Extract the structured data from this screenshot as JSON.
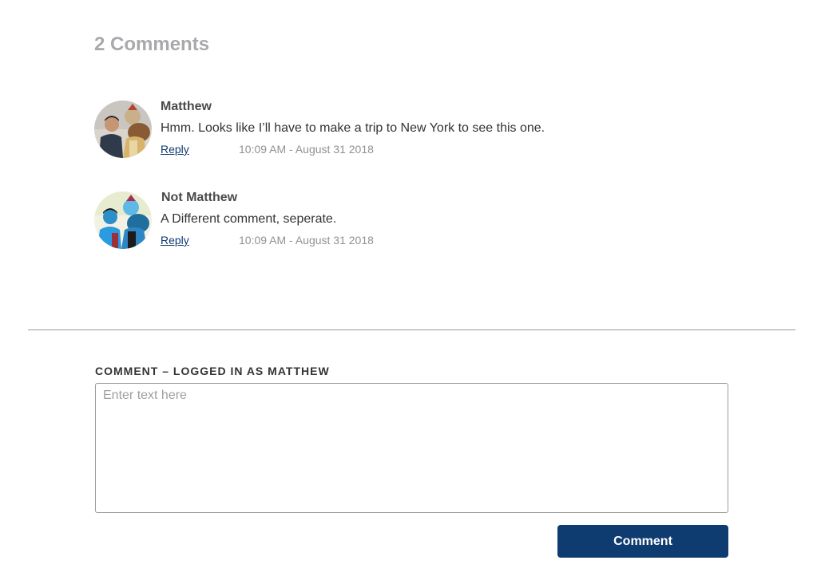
{
  "comments_header": {
    "title": "2 Comments"
  },
  "comments": [
    {
      "author": "Matthew",
      "text": "Hmm. Looks like I’ll have to make a trip to New York to see this one.",
      "reply_label": "Reply",
      "timestamp": "10:09 AM - August 31 2018",
      "avatar_icon": "user-photo-avatar"
    },
    {
      "author": "Not Matthew",
      "text": "A Different comment, seperate.",
      "reply_label": "Reply",
      "timestamp": "10:09 AM - August 31 2018",
      "avatar_icon": "user-photo-avatar"
    }
  ],
  "form": {
    "label": "COMMENT – LOGGED IN AS MATTHEW",
    "placeholder": "Enter text here",
    "value": "",
    "submit_label": "Comment"
  },
  "colors": {
    "accent": "#0e3b70",
    "heading": "#a7a9ac",
    "timestamp": "#8f9194",
    "divider": "#9a9a9a"
  }
}
